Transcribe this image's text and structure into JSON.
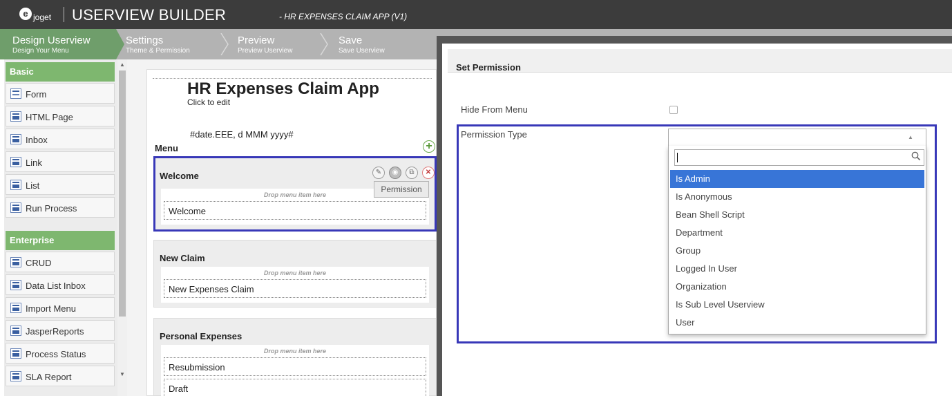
{
  "header": {
    "logo_text": "joget",
    "title": "USERVIEW BUILDER",
    "subtitle": "- HR EXPENSES CLAIM APP (V1)"
  },
  "steps": [
    {
      "title": "Design Userview",
      "subtitle": "Design Your Menu"
    },
    {
      "title": "Settings",
      "subtitle": "Theme & Permission"
    },
    {
      "title": "Preview",
      "subtitle": "Preview Userview"
    },
    {
      "title": "Save",
      "subtitle": "Save Userview"
    }
  ],
  "palette": {
    "basic_label": "Basic",
    "basic_items": [
      "Form",
      "HTML Page",
      "Inbox",
      "Link",
      "List",
      "Run Process"
    ],
    "enterprise_label": "Enterprise",
    "enterprise_items": [
      "CRUD",
      "Data List Inbox",
      "Import Menu",
      "JasperReports",
      "Process Status",
      "SLA Report"
    ]
  },
  "canvas": {
    "title": "HR Expenses Claim App",
    "click_to_edit": "Click to edit",
    "date_format": "#date.EEE, d MMM yyyy#",
    "menu_label": "Menu",
    "drop_hint": "Drop menu item here",
    "tooltip": "Permission",
    "categories": [
      {
        "label": "Welcome",
        "items": [
          "Welcome"
        ]
      },
      {
        "label": "New Claim",
        "items": [
          "New Expenses Claim"
        ]
      },
      {
        "label": "Personal Expenses",
        "items": [
          "Resubmission",
          "Draft"
        ]
      }
    ]
  },
  "dialog": {
    "title": "Set Permission",
    "hide_from_menu_label": "Hide From Menu",
    "permission_type_label": "Permission Type",
    "options": [
      "Is Admin",
      "Is Anonymous",
      "Bean Shell Script",
      "Department",
      "Group",
      "Logged In User",
      "Organization",
      "Is Sub Level Userview",
      "User"
    ],
    "selected_option": "Is Admin"
  },
  "colors": {
    "header_bg": "#3c3c3c",
    "active_step": "#6f9e6b",
    "palette_head": "#7eb76f",
    "highlight": "#3838b8",
    "option_selected": "#3875d7"
  }
}
